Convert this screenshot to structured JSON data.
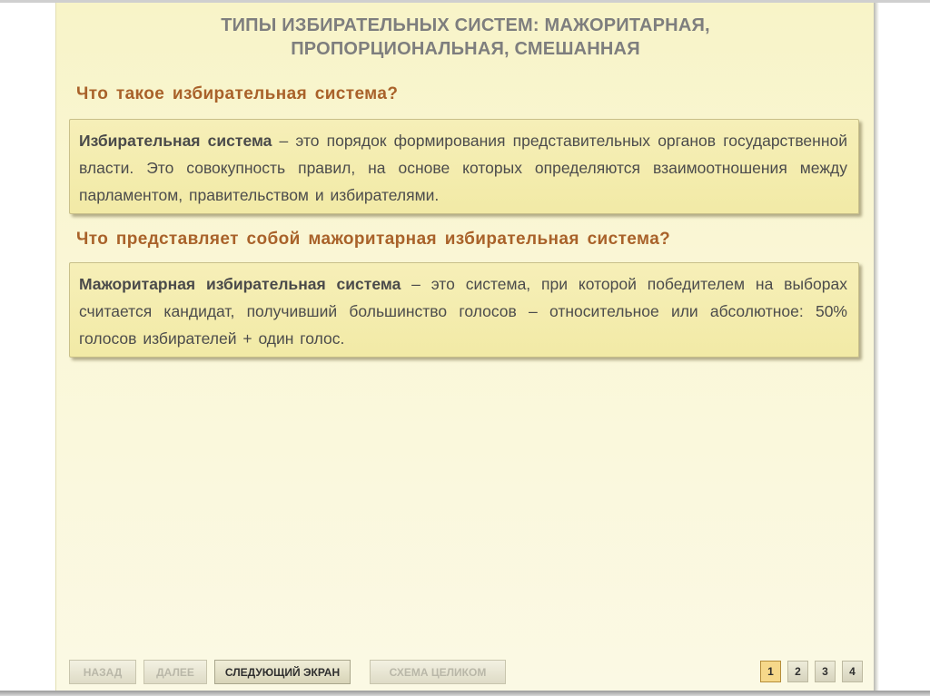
{
  "title_line1": "ТИПЫ ИЗБИРАТЕЛЬНЫХ СИСТЕМ: МАЖОРИТАРНАЯ,",
  "title_line2": "ПРОПОРЦИОНАЛЬНАЯ, СМЕШАННАЯ",
  "section1": {
    "question": "Что такое избирательная система?",
    "term": "Избирательная система",
    "definition": " – это порядок формирования представительных органов государственной власти. Это совокупность правил, на основе которых определяются взаимоотношения между парламентом, правительством и избирателями."
  },
  "section2": {
    "question": "Что представляет собой мажоритарная избирательная система?",
    "term": "Мажоритарная избирательная система",
    "definition": " – это система, при которой победителем на выборах считается кандидат, получивший большинство голосов – относительное или абсолютное: 50% голосов избирателей + один голос."
  },
  "nav": {
    "back": "НАЗАД",
    "next": "ДАЛЕЕ",
    "next_screen": "СЛЕДУЮЩИЙ ЭКРАН",
    "full_scheme": "СХЕМА ЦЕЛИКОМ"
  },
  "pages": [
    "1",
    "2",
    "3",
    "4"
  ],
  "current_page": "1",
  "colors": {
    "title": "#7e7e7e",
    "question": "#a9622a",
    "box_background": "#f4edb0",
    "page_current": "#f6d88a"
  }
}
